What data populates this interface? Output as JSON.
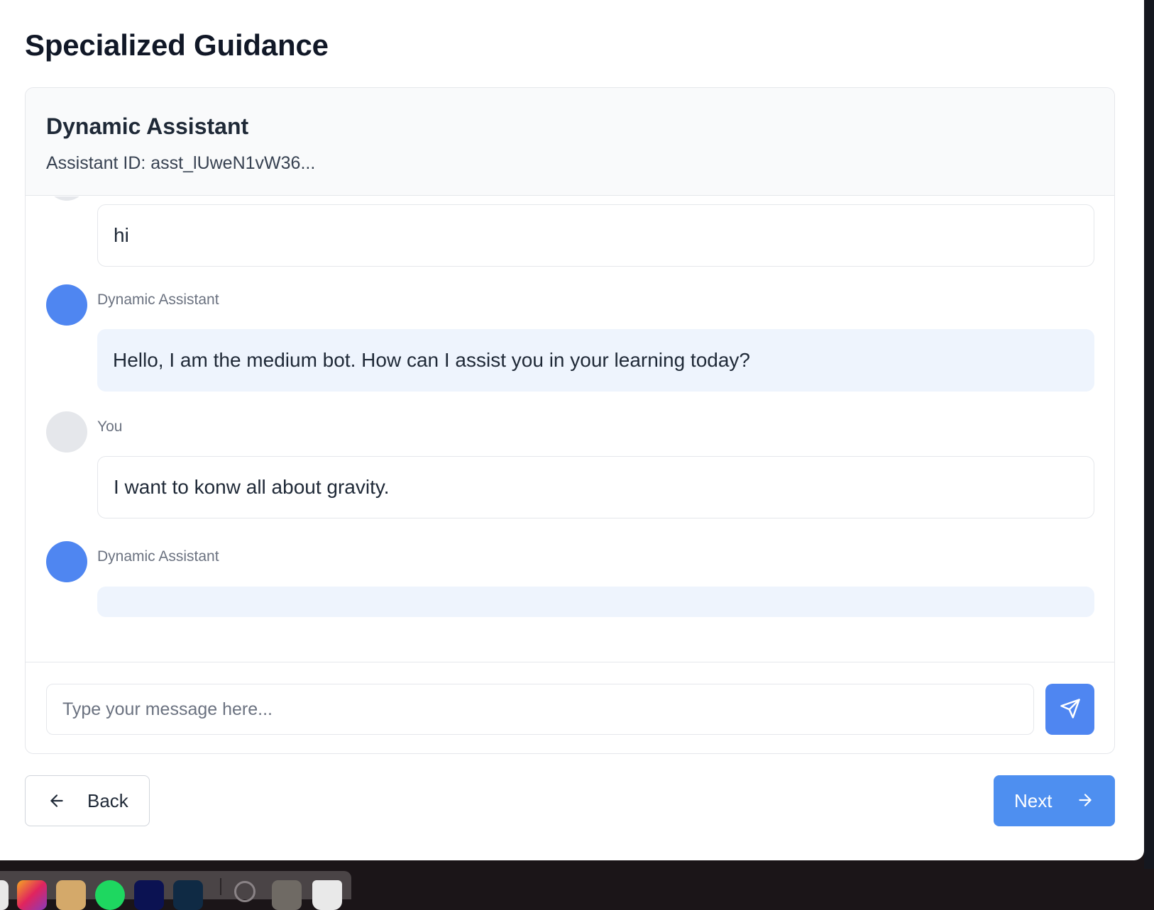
{
  "page": {
    "title": "Specialized Guidance"
  },
  "assistant": {
    "name": "Dynamic Assistant",
    "id_text": "Assistant ID: asst_lUweN1vW36..."
  },
  "messages": [
    {
      "role": "user",
      "sender": "",
      "text": "hi"
    },
    {
      "role": "assistant",
      "sender": "Dynamic Assistant",
      "text": "Hello, I am the medium bot. How can I assist you in your learning today?"
    },
    {
      "role": "user",
      "sender": "You",
      "text": "I want to konw all about gravity."
    },
    {
      "role": "assistant",
      "sender": "Dynamic Assistant",
      "text": ""
    }
  ],
  "composer": {
    "placeholder": "Type your message here...",
    "value": ""
  },
  "navigation": {
    "back_label": "Back",
    "next_label": "Next"
  },
  "colors": {
    "accent": "#4f86f1",
    "bot_bubble": "#eef4fd",
    "user_avatar": "#e5e7eb"
  },
  "icons": {
    "send": "send-icon",
    "back": "arrow-left-icon",
    "next": "arrow-right-icon"
  }
}
